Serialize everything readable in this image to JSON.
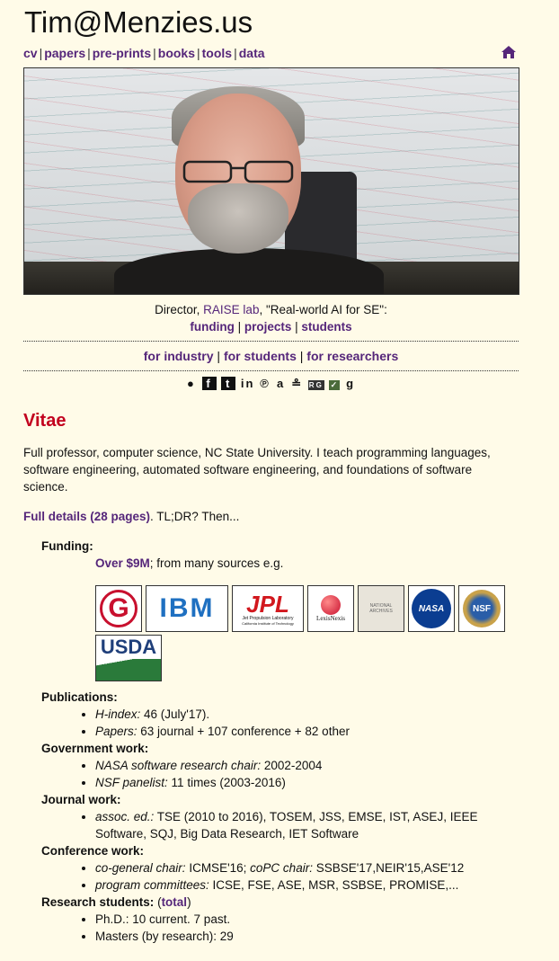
{
  "site_title": "Tim@Menzies.us",
  "nav": [
    "cv",
    "papers",
    "pre-prints",
    "books",
    "tools",
    "data"
  ],
  "director": {
    "prefix": "Director, ",
    "lab": "RAISE lab",
    "suffix": ", \"Real-world AI for SE\":"
  },
  "lab_links": [
    "funding",
    "projects",
    "students"
  ],
  "audience_links": [
    "for industry",
    "for students",
    "for researchers"
  ],
  "social_icons": [
    "github-icon",
    "facebook-icon",
    "twitter-icon",
    "linkedin-icon",
    "pinterest-icon",
    "amazon-icon",
    "scholar-icon",
    "researchgate-icon",
    "orcid-icon",
    "goodreads-icon"
  ],
  "vitae": {
    "heading": "Vitae",
    "intro": "Full professor, computer science, NC State University. I teach programming languages, software engineering, automated software engineering, and foundations of software science.",
    "details_link": "Full details (28 pages)",
    "details_suffix": ". TL;DR? Then..."
  },
  "funding": {
    "label": "Funding:",
    "amount_link": "Over $9M",
    "amount_suffix": "; from many sources e.g.",
    "sponsors": [
      "G",
      "IBM",
      "JPL",
      "LexisNexis",
      "NATIONAL ARCHIVES",
      "NASA",
      "NSF",
      "USDA"
    ],
    "jpl_sub": "Jet Propulsion Laboratory",
    "jpl_sub2": "California Institute of Technology"
  },
  "publications": {
    "label": "Publications:",
    "items": [
      {
        "em": "H-index:",
        "text": " 46 (July'17)."
      },
      {
        "em": "Papers:",
        "text": " 63 journal + 107 conference + 82 other"
      }
    ]
  },
  "government": {
    "label": "Government work:",
    "items": [
      {
        "em": "NASA software research chair:",
        "text": " 2002-2004"
      },
      {
        "em": "NSF panelist:",
        "text": " 11 times (2003-2016)"
      }
    ]
  },
  "journal": {
    "label": "Journal work:",
    "items": [
      {
        "em": "assoc. ed.:",
        "text": " TSE (2010 to 2016), TOSEM, JSS, EMSE, IST, ASEJ, IEEE Software, SQJ, Big Data Research, IET Software"
      }
    ]
  },
  "conference": {
    "label": "Conference work:",
    "items": [
      {
        "em": "co-general chair:",
        "text": " ICMSE'16; ",
        "em2": "coPC chair:",
        "text2": " SSBSE'17,NEIR'15,ASE'12"
      },
      {
        "em": "program committees:",
        "text": " ICSE, FSE, ASE, MSR, SSBSE, PROMISE,..."
      }
    ]
  },
  "students": {
    "label": "Research students:",
    "total_link": "total",
    "items": [
      "Ph.D.: 10 current. 7 past.",
      "Masters (by research): 29"
    ]
  },
  "colors": {
    "link": "#55267a",
    "heading": "#c2001e",
    "background": "#fffbe8"
  }
}
